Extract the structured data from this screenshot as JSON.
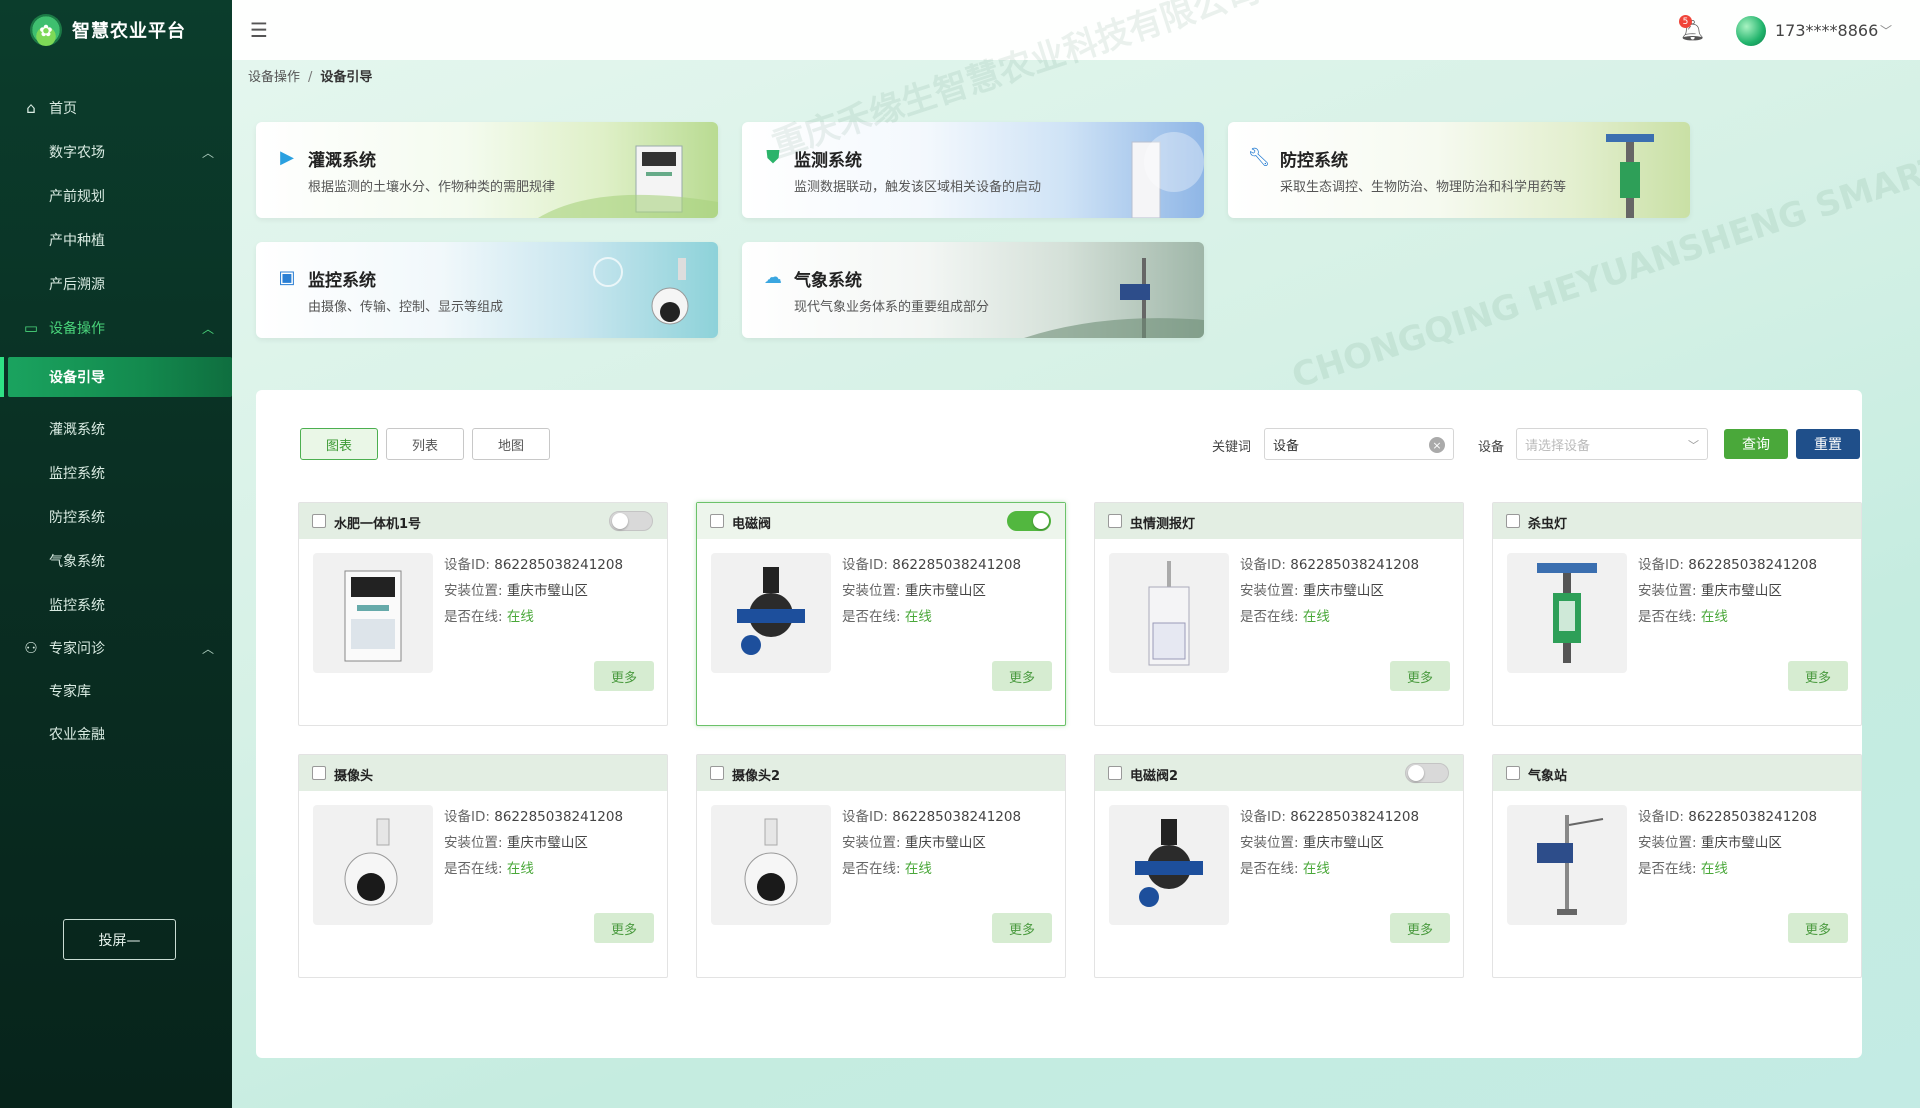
{
  "app": {
    "title": "智慧农业平台"
  },
  "header": {
    "notification_count": "5",
    "username": "173****8866"
  },
  "sidebar": {
    "items": [
      {
        "label": "首页",
        "icon": "home-icon"
      },
      {
        "label": "数字农场"
      },
      {
        "label": "产前规划"
      },
      {
        "label": "产中种植"
      },
      {
        "label": "产后溯源"
      },
      {
        "label": "设备操作",
        "icon": "device-icon"
      },
      {
        "label": "设备引导"
      },
      {
        "label": "灌溉系统"
      },
      {
        "label": "监控系统"
      },
      {
        "label": "防控系统"
      },
      {
        "label": "气象系统"
      },
      {
        "label": "监控系统"
      },
      {
        "label": "专家问诊",
        "icon": "users-icon"
      },
      {
        "label": "专家库"
      },
      {
        "label": "农业金融"
      }
    ],
    "cast_button": "投屏—"
  },
  "breadcrumb": {
    "parent": "设备操作",
    "separator": "/",
    "current": "设备引导"
  },
  "systems": [
    {
      "title": "灌溉系统",
      "desc": "根据监测的土壤水分、作物种类的需肥规律"
    },
    {
      "title": "监测系统",
      "desc": "监测数据联动，触发该区域相关设备的启动"
    },
    {
      "title": "防控系统",
      "desc": "采取生态调控、生物防治、物理防治和科学用药等"
    },
    {
      "title": "监控系统",
      "desc": "由摄像、传输、控制、显示等组成"
    },
    {
      "title": "气象系统",
      "desc": "现代气象业务体系的重要组成部分"
    }
  ],
  "toolbar": {
    "views": [
      "图表",
      "列表",
      "地图"
    ],
    "keyword_label": "关键词",
    "keyword_value": "设备",
    "device_label": "设备",
    "device_placeholder": "请选择设备",
    "query_label": "查询",
    "reset_label": "重置"
  },
  "device_labels": {
    "id": "设备ID:",
    "location": "安装位置:",
    "online": "是否在线:",
    "more": "更多"
  },
  "devices": [
    {
      "name": "水肥一体机1号",
      "id": "862285038241208",
      "location": "重庆市璧山区",
      "online": "在线",
      "toggle": "off"
    },
    {
      "name": "电磁阀",
      "id": "862285038241208",
      "location": "重庆市璧山区",
      "online": "在线",
      "toggle": "on"
    },
    {
      "name": "虫情测报灯",
      "id": "862285038241208",
      "location": "重庆市璧山区",
      "online": "在线"
    },
    {
      "name": "杀虫灯",
      "id": "862285038241208",
      "location": "重庆市璧山区",
      "online": "在线"
    },
    {
      "name": "摄像头",
      "id": "862285038241208",
      "location": "重庆市璧山区",
      "online": "在线"
    },
    {
      "name": "摄像头2",
      "id": "862285038241208",
      "location": "重庆市璧山区",
      "online": "在线"
    },
    {
      "name": "电磁阀2",
      "id": "862285038241208",
      "location": "重庆市璧山区",
      "online": "在线",
      "toggle": "off"
    },
    {
      "name": "气象站",
      "id": "862285038241208",
      "location": "重庆市璧山区",
      "online": "在线"
    }
  ],
  "watermark": {
    "cn": "重庆禾缘生智慧农业科技有限公司",
    "en": "CHONGQING HEYUANSHENG SMART AGRICULTURE"
  },
  "colors": {
    "accent": "#4aa83a",
    "sidebar": "#0a2f23",
    "reset": "#1f4f8a"
  }
}
